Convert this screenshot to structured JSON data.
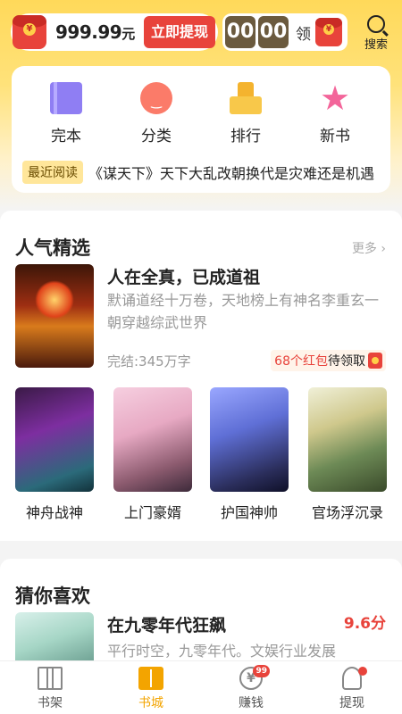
{
  "header": {
    "balance": "999.99",
    "balance_unit": "元",
    "withdraw_label": "立即提现",
    "timer_minutes": "00",
    "timer_seconds": "00",
    "timer_claim": "领",
    "search_label": "搜索"
  },
  "categories": [
    {
      "label": "完本",
      "icon": "book-icon"
    },
    {
      "label": "分类",
      "icon": "face-icon"
    },
    {
      "label": "排行",
      "icon": "rank-icon"
    },
    {
      "label": "新书",
      "icon": "star-icon"
    }
  ],
  "recent": {
    "tag": "最近阅读",
    "text": "《谋天下》天下大乱改朝换代是灾难还是机遇"
  },
  "popular": {
    "title": "人气精选",
    "more": "更多 ›",
    "hero": {
      "title": "人在全真，已成道祖",
      "desc": "默诵道经十万卷，天地榜上有神名李重玄一朝穿越综武世界",
      "meta": "完结:345万字",
      "redpack_count": "68个红包",
      "redpack_suffix": "待领取"
    },
    "books": [
      {
        "title": "神舟战神"
      },
      {
        "title": "上门豪婿"
      },
      {
        "title": "护国神帅"
      },
      {
        "title": "官场浮沉录"
      }
    ]
  },
  "guess": {
    "title": "猜你喜欢",
    "book": {
      "title": "在九零年代狂飙",
      "score": "9.6分",
      "desc": "平行时空，九零年代。文娱行业发展"
    }
  },
  "nav": [
    {
      "label": "书架",
      "icon": "bookshelf-icon"
    },
    {
      "label": "书城",
      "icon": "bookstore-icon"
    },
    {
      "label": "赚钱",
      "icon": "yuan-icon",
      "badge": "99"
    },
    {
      "label": "提现",
      "icon": "user-icon"
    }
  ],
  "colors": {
    "accent": "#ffd95a",
    "red": "#e8433b",
    "nav_active": "#f3a400"
  }
}
